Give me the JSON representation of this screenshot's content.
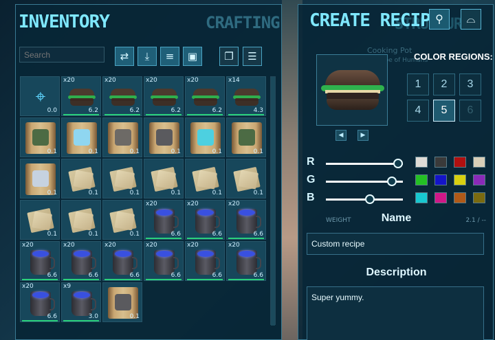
{
  "left": {
    "title": "INVENTORY",
    "tab_crafting": "CRAFTING",
    "search": {
      "placeholder": "Search"
    },
    "toolbar": {
      "transfer_icon": "⇄",
      "drop_icon": "⤓",
      "sort_icon": "≡",
      "folder_icon": "▣",
      "stack_icon": "❐",
      "list_icon": "☰"
    },
    "slots": [
      {
        "kind": "blueprint-glyph",
        "qty": "",
        "wt": "0.0"
      },
      {
        "kind": "burger",
        "qty": "x20",
        "wt": "6.2"
      },
      {
        "kind": "burger",
        "qty": "x20",
        "wt": "6.2"
      },
      {
        "kind": "burger",
        "qty": "x20",
        "wt": "6.2"
      },
      {
        "kind": "burger",
        "qty": "x20",
        "wt": "6.2"
      },
      {
        "kind": "burger",
        "qty": "x14",
        "wt": "4.3"
      },
      {
        "kind": "scroll-green",
        "qty": "",
        "wt": "0.1"
      },
      {
        "kind": "scroll-glass",
        "qty": "",
        "wt": "0.1"
      },
      {
        "kind": "scroll-gray",
        "qty": "",
        "wt": "0.1"
      },
      {
        "kind": "scroll-cup",
        "qty": "",
        "wt": "0.1"
      },
      {
        "kind": "scroll-teal",
        "qty": "",
        "wt": "0.1"
      },
      {
        "kind": "scroll-green",
        "qty": "",
        "wt": "0.1"
      },
      {
        "kind": "scroll-glass2",
        "qty": "",
        "wt": "0.1"
      },
      {
        "kind": "note",
        "qty": "",
        "wt": "0.1"
      },
      {
        "kind": "note",
        "qty": "",
        "wt": "0.1"
      },
      {
        "kind": "note",
        "qty": "",
        "wt": "0.1"
      },
      {
        "kind": "note",
        "qty": "",
        "wt": "0.1"
      },
      {
        "kind": "note",
        "qty": "",
        "wt": "0.1"
      },
      {
        "kind": "note",
        "qty": "",
        "wt": "0.1"
      },
      {
        "kind": "note",
        "qty": "",
        "wt": "0.1"
      },
      {
        "kind": "note",
        "qty": "",
        "wt": "0.1"
      },
      {
        "kind": "cup",
        "qty": "x20",
        "wt": "6.6"
      },
      {
        "kind": "cup",
        "qty": "x20",
        "wt": "6.6"
      },
      {
        "kind": "cup",
        "qty": "x20",
        "wt": "6.6"
      },
      {
        "kind": "cup",
        "qty": "x20",
        "wt": "6.6"
      },
      {
        "kind": "cup",
        "qty": "x20",
        "wt": "6.6"
      },
      {
        "kind": "cup",
        "qty": "x20",
        "wt": "6.6"
      },
      {
        "kind": "cup",
        "qty": "x20",
        "wt": "6.6"
      },
      {
        "kind": "cup",
        "qty": "x20",
        "wt": "6.6"
      },
      {
        "kind": "cup",
        "qty": "x20",
        "wt": "6.6"
      },
      {
        "kind": "cup",
        "qty": "x20",
        "wt": "6.6"
      },
      {
        "kind": "cup",
        "qty": "x9",
        "wt": "3.0"
      },
      {
        "kind": "scroll-cup",
        "qty": "",
        "wt": "0.1"
      }
    ]
  },
  "right": {
    "title": "CREATE RECIPE",
    "tab_structure": "STRUCTURE",
    "tab_buttons": {
      "food_icon": "⚲",
      "drink_icon": "⌓"
    },
    "ghost_texts": {
      "cooking_pot": "Cooking Pot",
      "owner": "Owner: Tribe of Humans"
    },
    "color_regions_label": "COLOR REGIONS:",
    "regions": [
      {
        "label": "1",
        "state": "normal"
      },
      {
        "label": "2",
        "state": "normal"
      },
      {
        "label": "3",
        "state": "normal"
      },
      {
        "label": "4",
        "state": "normal"
      },
      {
        "label": "5",
        "state": "selected"
      },
      {
        "label": "6",
        "state": "disabled"
      }
    ],
    "prev_icon": "◀",
    "next_icon": "▶",
    "sliders": [
      {
        "label": "R",
        "value": 0.94
      },
      {
        "label": "G",
        "value": 0.86
      },
      {
        "label": "B",
        "value": 0.57
      }
    ],
    "swatches": [
      [
        "#dedbd6",
        "#3a3a3a",
        "#b01010",
        "#d8cfb8"
      ],
      [
        "#24c024",
        "#1414c8",
        "#d8d010",
        "#8a2ab8"
      ],
      [
        "#18c8d0",
        "#d01888",
        "#b05a18",
        "#7a6a10"
      ]
    ],
    "weight_label": "WEIGHT",
    "weight_value": "2.1 / --",
    "name_title": "Name",
    "name_value": "Custom recipe",
    "description_title": "Description",
    "description_value": "Super yummy."
  }
}
